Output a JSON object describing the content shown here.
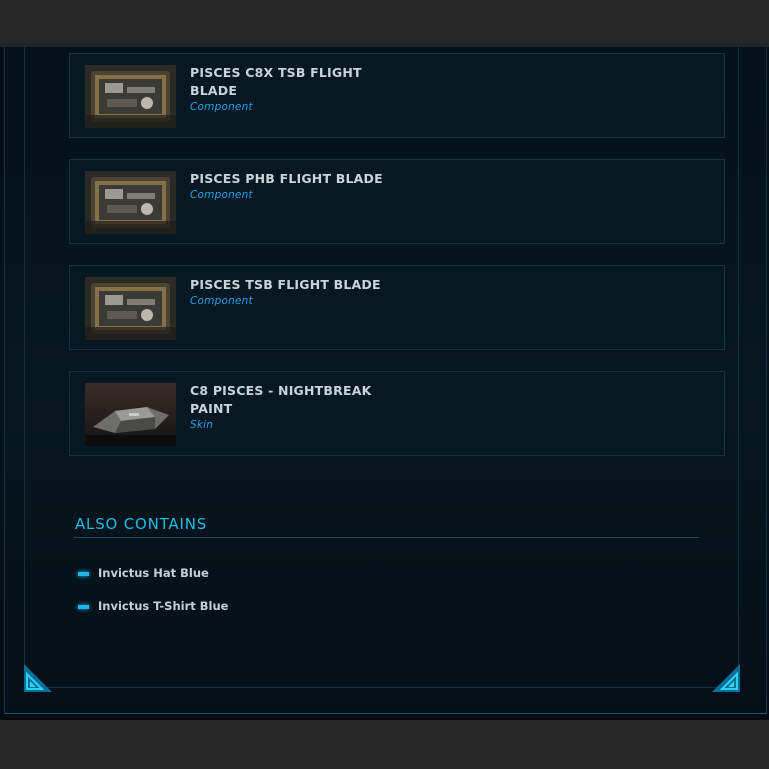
{
  "items": [
    {
      "title": "PISCES C8X TSB FLIGHT BLADE",
      "type": "Component",
      "thumb": "flight-blade-thumbnail"
    },
    {
      "title": "PISCES PHB FLIGHT BLADE",
      "type": "Component",
      "thumb": "flight-blade-thumbnail"
    },
    {
      "title": "PISCES TSB FLIGHT BLADE",
      "type": "Component",
      "thumb": "flight-blade-thumbnail"
    },
    {
      "title": "C8 PISCES - NIGHTBREAK PAINT",
      "type": "Skin",
      "thumb": "ship-paint-thumbnail"
    }
  ],
  "also_contains": {
    "title": "ALSO CONTAINS",
    "items": [
      "Invictus Hat Blue",
      "Invictus T-Shirt Blue"
    ]
  },
  "colors": {
    "accent": "#1fbde6",
    "type_label": "#19a0e6",
    "card_bg": "#071823",
    "card_border": "#143346"
  }
}
